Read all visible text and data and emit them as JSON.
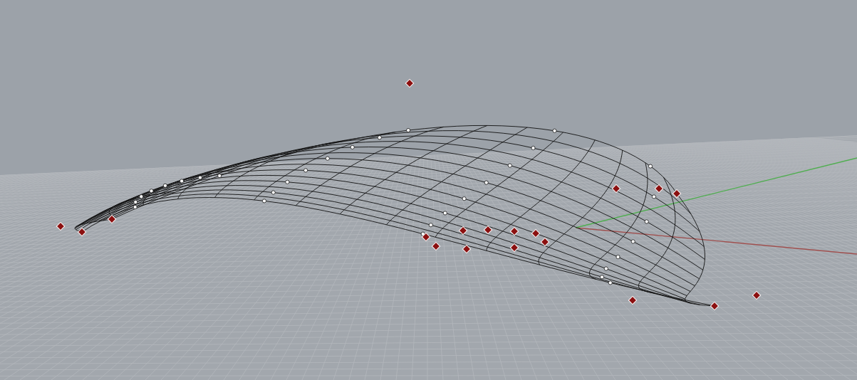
{
  "viewport": {
    "grid_visible": true,
    "world_axes_visible": true
  }
}
